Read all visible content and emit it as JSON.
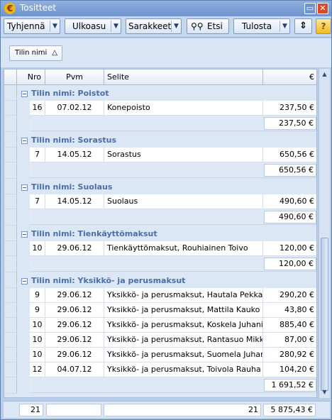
{
  "window": {
    "title": "Tositteet",
    "app_icon": "€"
  },
  "toolbar": {
    "clear": "Tyhjennä",
    "layout": "Ulkoasu",
    "columns": "Sarakkeet",
    "search": "Etsi",
    "print": "Tulosta"
  },
  "group_by": {
    "label": "Tilin nimi"
  },
  "columns": {
    "nro": "Nro",
    "pvm": "Pvm",
    "selite": "Selite",
    "eur": "€"
  },
  "groups": [
    {
      "title": "Tilin nimi: Poistot",
      "rows": [
        {
          "nro": "16",
          "pvm": "07.02.12",
          "selite": "Konepoisto",
          "eur": "237,50 €"
        }
      ],
      "sum": "237,50 €"
    },
    {
      "title": "Tilin nimi: Sorastus",
      "rows": [
        {
          "nro": "7",
          "pvm": "14.05.12",
          "selite": "Sorastus",
          "eur": "650,56 €"
        }
      ],
      "sum": "650,56 €"
    },
    {
      "title": "Tilin nimi: Suolaus",
      "rows": [
        {
          "nro": "7",
          "pvm": "14.05.12",
          "selite": "Suolaus",
          "eur": "490,60 €"
        }
      ],
      "sum": "490,60 €"
    },
    {
      "title": "Tilin nimi: Tienkäyttömaksut",
      "rows": [
        {
          "nro": "10",
          "pvm": "29.06.12",
          "selite": "Tienkäyttömaksut, Rouhiainen Toivo",
          "eur": "120,00 €"
        }
      ],
      "sum": "120,00 €"
    },
    {
      "title": "Tilin nimi: Yksikkö- ja perusmaksut",
      "rows": [
        {
          "nro": "9",
          "pvm": "29.06.12",
          "selite": "Yksikkö- ja perusmaksut, Hautala Pekka",
          "eur": "290,20 €"
        },
        {
          "nro": "9",
          "pvm": "29.06.12",
          "selite": "Yksikkö- ja perusmaksut, Mattila Kauko",
          "eur": "43,80 €"
        },
        {
          "nro": "10",
          "pvm": "29.06.12",
          "selite": "Yksikkö- ja perusmaksut, Koskela Juhani",
          "eur": "885,40 €"
        },
        {
          "nro": "10",
          "pvm": "29.06.12",
          "selite": "Yksikkö- ja perusmaksut, Rantasuo Mikko",
          "eur": "87,00 €"
        },
        {
          "nro": "10",
          "pvm": "29.06.12",
          "selite": "Yksikkö- ja perusmaksut, Suomela Juhani",
          "eur": "280,92 €"
        },
        {
          "nro": "12",
          "pvm": "04.07.12",
          "selite": "Yksikkö- ja perusmaksut, Toivola Rauha",
          "eur": "104,20 €"
        }
      ],
      "sum": "1 691,52 €"
    }
  ],
  "footer": {
    "count": "21",
    "count2": "21",
    "total": "5 875,43 €"
  }
}
